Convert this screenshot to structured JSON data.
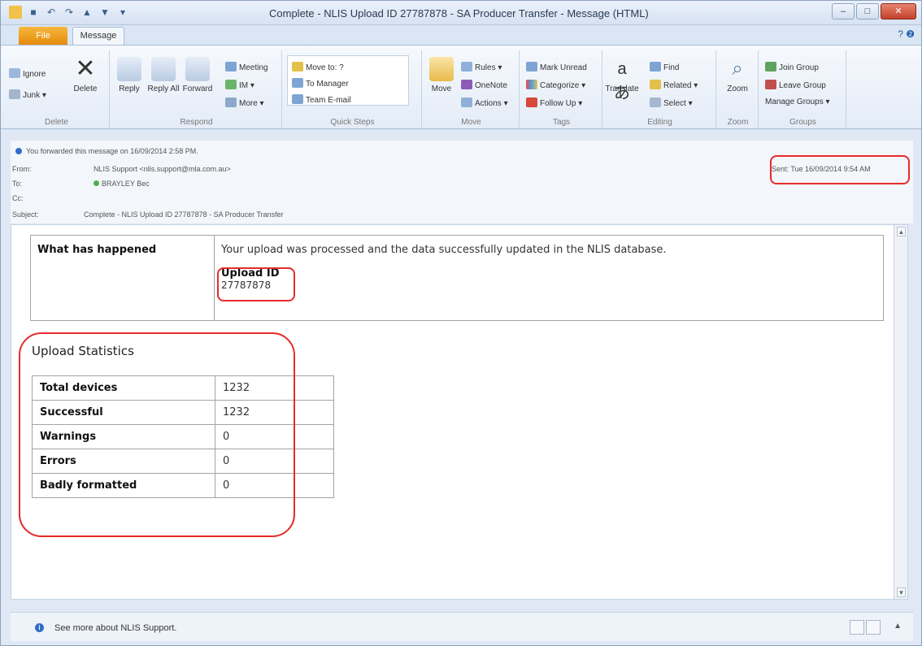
{
  "window": {
    "title": "Complete - NLIS Upload ID 27787878 - SA Producer Transfer - Message (HTML)"
  },
  "tabs": {
    "file": "File",
    "message": "Message",
    "help": "? ❷"
  },
  "ribbon": {
    "delete_group": {
      "ignore": "Ignore",
      "junk": "Junk ▾",
      "delete": "Delete",
      "label": "Delete"
    },
    "respond_group": {
      "reply": "Reply",
      "reply_all": "Reply All",
      "forward": "Forward",
      "meeting": "Meeting",
      "im": "IM ▾",
      "more": "More ▾",
      "label": "Respond"
    },
    "quick_steps": {
      "move_to": "Move to: ?",
      "to_manager": "To Manager",
      "team_email": "Team E-mail",
      "label": "Quick Steps"
    },
    "move_group": {
      "move": "Move",
      "rules": "Rules ▾",
      "onenote": "OneNote",
      "actions": "Actions ▾",
      "label": "Move"
    },
    "tags_group": {
      "mark_unread": "Mark Unread",
      "categorize": "Categorize ▾",
      "follow_up": "Follow Up ▾",
      "label": "Tags"
    },
    "editing_group": {
      "translate": "Translate",
      "find": "Find",
      "related": "Related ▾",
      "select": "Select ▾",
      "label": "Editing"
    },
    "zoom_group": {
      "zoom": "Zoom",
      "label": "Zoom"
    },
    "groups_group": {
      "join": "Join Group",
      "leave": "Leave Group",
      "manage": "Manage Groups ▾",
      "label": "Groups"
    }
  },
  "header": {
    "info": "You forwarded this message on 16/09/2014 2:58 PM.",
    "from_label": "From:",
    "from_value": "NLIS Support <nlis.support@mla.com.au>",
    "to_label": "To:",
    "to_value": "BRAYLEY Bec",
    "cc_label": "Cc:",
    "subject_label": "Subject:",
    "subject_value": "Complete - NLIS Upload ID 27787878 - SA Producer Transfer",
    "sent": "Sent:  Tue 16/09/2014 9:54 AM"
  },
  "message": {
    "happened_label": "What has happened",
    "happened_text": "Your upload was processed and the data successfully updated in the NLIS database.",
    "upload_id_label": "Upload ID",
    "upload_id_value": "27787878",
    "stats_title": "Upload Statistics",
    "stats": [
      {
        "label": "Total devices",
        "value": "1232"
      },
      {
        "label": "Successful",
        "value": "1232"
      },
      {
        "label": "Warnings",
        "value": "0"
      },
      {
        "label": "Errors",
        "value": "0"
      },
      {
        "label": "Badly formatted",
        "value": "0"
      }
    ]
  },
  "people_pane": {
    "text": "See more about NLIS Support."
  },
  "colors": {
    "annotation": "#e52b2b",
    "file_tab": "#e58a0b",
    "accent": "#2f6fc9"
  }
}
